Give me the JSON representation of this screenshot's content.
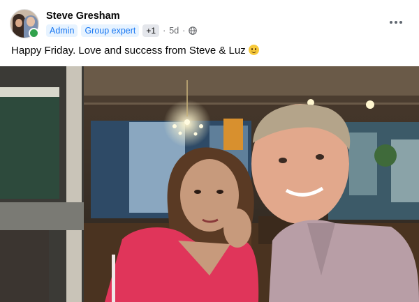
{
  "post": {
    "author": "Steve Gresham",
    "badges": [
      "Admin",
      "Group expert"
    ],
    "extra_badges": "+1",
    "time": "5d",
    "separator": "·",
    "text": "Happy Friday. Love and success from Steve & Luz",
    "emoji": "slightly-smiling-face",
    "privacy_icon": "globe-icon",
    "menu_icon": "more-horizontal-icon"
  },
  "colors": {
    "badge_text": "#1877f2",
    "badge_bg": "#e7f3ff",
    "online": "#31a24c"
  }
}
